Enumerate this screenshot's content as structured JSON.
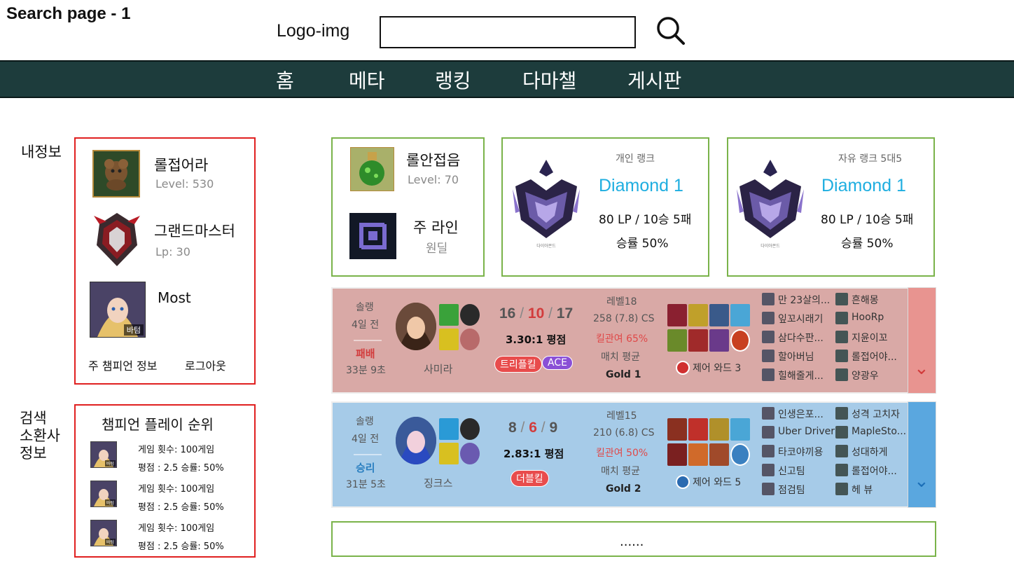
{
  "page": {
    "title": "Search page - 1"
  },
  "header": {
    "logo": "Logo-img",
    "search_value": "",
    "search_icon": "search-icon"
  },
  "nav": {
    "items": [
      "홈",
      "메타",
      "랭킹",
      "다마챌",
      "게시판"
    ]
  },
  "my_info": {
    "section_label": "내정보",
    "summoner_name": "롤접어라",
    "level": "Level: 530",
    "tier_name": "그랜드마스터",
    "lp": "Lp: 30",
    "most_label": "Most",
    "most_champ_badge": "바텀",
    "main_champ_link": "주 챔피언 정보",
    "logout": "로그아웃"
  },
  "search_info": {
    "section_label": "검색\n소환사\n정보",
    "ranking_title": "챔피언 플레이 순위",
    "rows": [
      {
        "games": "게임 횟수: 100게임",
        "stats": "평점 : 2.5 승률: 50%",
        "badge": "바텀"
      },
      {
        "games": "게임 횟수: 100게임",
        "stats": "평점 : 2.5 승률: 50%",
        "badge": "바텀"
      },
      {
        "games": "게임 횟수: 100게임",
        "stats": "평점 : 2.5 승률: 50%",
        "badge": "바텀"
      }
    ]
  },
  "profile": {
    "name": "롤안접음",
    "level": "Level: 70",
    "main_line_label": "주 라인",
    "main_line_value": "원딜"
  },
  "solo_rank": {
    "label": "개인 랭크",
    "tier": "Diamond 1",
    "record": "80 LP / 10승 5패",
    "winrate": "승률 50%",
    "emblem_caption": "다이아몬드"
  },
  "flex_rank": {
    "label": "자유 랭크 5대5",
    "tier": "Diamond 1",
    "record": "80 LP / 10승 5패",
    "winrate": "승률 50%",
    "emblem_caption": "다이아몬드"
  },
  "matches": [
    {
      "queue": "솔랭",
      "ago": "4일 전",
      "result": "패배",
      "duration": "33분 9초",
      "champion": "사미라",
      "kills": "16",
      "deaths": "10",
      "assists": "17",
      "sep": "/",
      "kda": "3.30:1 평점",
      "badges": [
        {
          "text": "트리플킬",
          "color": "#e84c4c"
        },
        {
          "text": "ACE",
          "color": "#8a4fd6"
        }
      ],
      "level": "레벨18",
      "cs": "258 (7.8) CS",
      "kp": "킬관여 65%",
      "avg_label": "매치 평균",
      "avg_tier": "Gold 1",
      "ward": "제어 와드 3",
      "team1": [
        "만 23살의...",
        "잎꼬시래기",
        "삼다수판...",
        "할아버님",
        "힐해줄게..."
      ],
      "team2": [
        "흔해몽",
        "HooRp",
        "지윤이꼬",
        "롤접어야...",
        "양광우"
      ],
      "bg": "#d9a9a6",
      "accent": "#e89490",
      "result_color": "#d23c3c",
      "arrow": "⌄"
    },
    {
      "queue": "솔랭",
      "ago": "4일 전",
      "result": "승리",
      "duration": "31분 5초",
      "champion": "징크스",
      "kills": "8",
      "deaths": "6",
      "assists": "9",
      "sep": "/",
      "kda": "2.83:1 평점",
      "badges": [
        {
          "text": "더블킬",
          "color": "#e84c4c"
        }
      ],
      "level": "레벨15",
      "cs": "210 (6.8) CS",
      "kp": "킬관여 50%",
      "avg_label": "매치 평균",
      "avg_tier": "Gold 2",
      "ward": "제어 와드 5",
      "team1": [
        "인생은포...",
        "Uber Driver",
        "타코야끼용",
        "신고팀",
        "점검팀"
      ],
      "team2": [
        "성격 고치자",
        "MapleSto...",
        "성대하게",
        "롤접어야...",
        "헤 뷰"
      ],
      "bg": "#a6cbe8",
      "accent": "#5aa7df",
      "result_color": "#2a7fc0",
      "arrow": "⌄"
    }
  ],
  "more": {
    "text": "......"
  }
}
